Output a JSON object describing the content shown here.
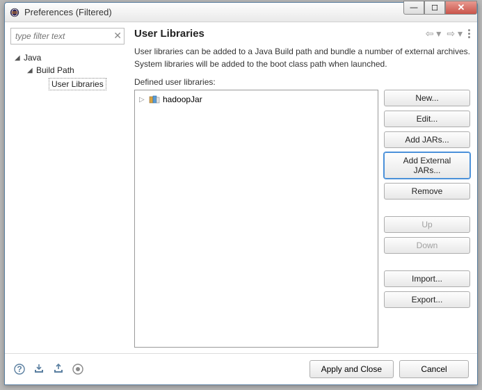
{
  "window": {
    "title": "Preferences (Filtered)"
  },
  "filter": {
    "placeholder": "type filter text"
  },
  "tree": {
    "java": "Java",
    "buildPath": "Build Path",
    "userLibraries": "User Libraries"
  },
  "main": {
    "title": "User Libraries",
    "description": "User libraries can be added to a Java Build path and bundle a number of external archives. System libraries will be added to the boot class path when launched.",
    "definedLabel": "Defined user libraries:",
    "listItems": [
      {
        "name": "hadoopJar"
      }
    ]
  },
  "buttons": {
    "new": "New...",
    "edit": "Edit...",
    "addJars": "Add JARs...",
    "addExternalJars": "Add External JARs...",
    "remove": "Remove",
    "up": "Up",
    "down": "Down",
    "import": "Import...",
    "export": "Export..."
  },
  "footer": {
    "apply": "Apply and Close",
    "cancel": "Cancel"
  }
}
